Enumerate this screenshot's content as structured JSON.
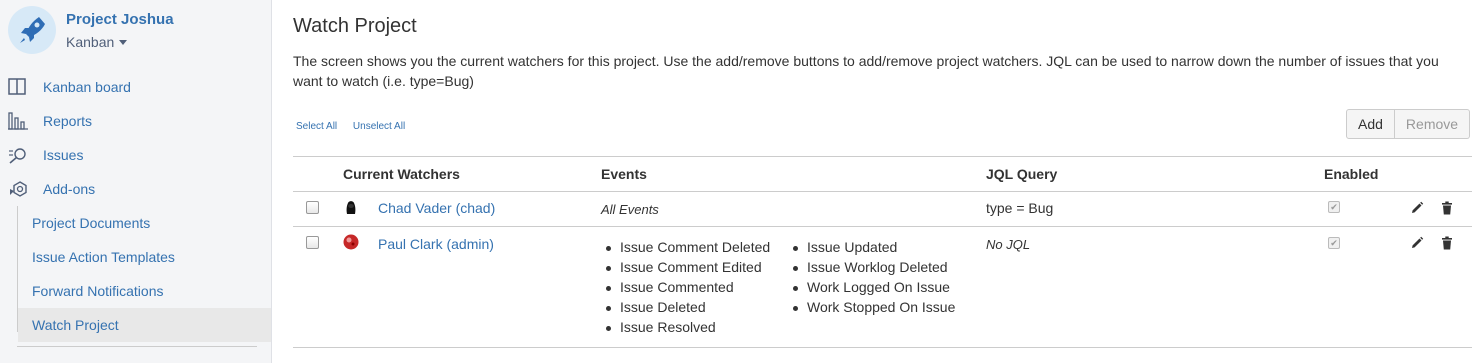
{
  "project": {
    "name": "Project Joshua",
    "type": "Kanban"
  },
  "nav": {
    "items": [
      {
        "label": "Kanban board",
        "icon": "board-icon"
      },
      {
        "label": "Reports",
        "icon": "reports-icon"
      },
      {
        "label": "Issues",
        "icon": "issues-icon"
      },
      {
        "label": "Add-ons",
        "icon": "addons-icon"
      }
    ],
    "subitems": [
      {
        "label": "Project Documents"
      },
      {
        "label": "Issue Action Templates"
      },
      {
        "label": "Forward Notifications"
      },
      {
        "label": "Watch Project",
        "active": true
      }
    ]
  },
  "page": {
    "title": "Watch Project",
    "description": "The screen shows you the current watchers for this project. Use the add/remove buttons to add/remove project watchers. JQL can be used to narrow down the number of issues that you want to watch (i.e. type=Bug)",
    "select_all": "Select All",
    "unselect_all": "Unselect All",
    "add_label": "Add",
    "remove_label": "Remove"
  },
  "table": {
    "headers": {
      "watchers": "Current Watchers",
      "events": "Events",
      "jql": "JQL Query",
      "enabled": "Enabled"
    },
    "rows": [
      {
        "user": "Chad Vader (chad)",
        "events_text": "All Events",
        "jql": "type = Bug",
        "enabled": true
      },
      {
        "user": "Paul Clark (admin)",
        "events_col1": [
          "Issue Comment Deleted",
          "Issue Comment Edited",
          "Issue Commented",
          "Issue Deleted",
          "Issue Resolved"
        ],
        "events_col2": [
          "Issue Updated",
          "Issue Worklog Deleted",
          "Work Logged On Issue",
          "Work Stopped On Issue"
        ],
        "jql": "No JQL",
        "enabled": true
      }
    ]
  },
  "colors": {
    "link": "#3572b0",
    "sidebar_bg": "#f4f5f7",
    "active_bg": "#e8e8e8"
  }
}
